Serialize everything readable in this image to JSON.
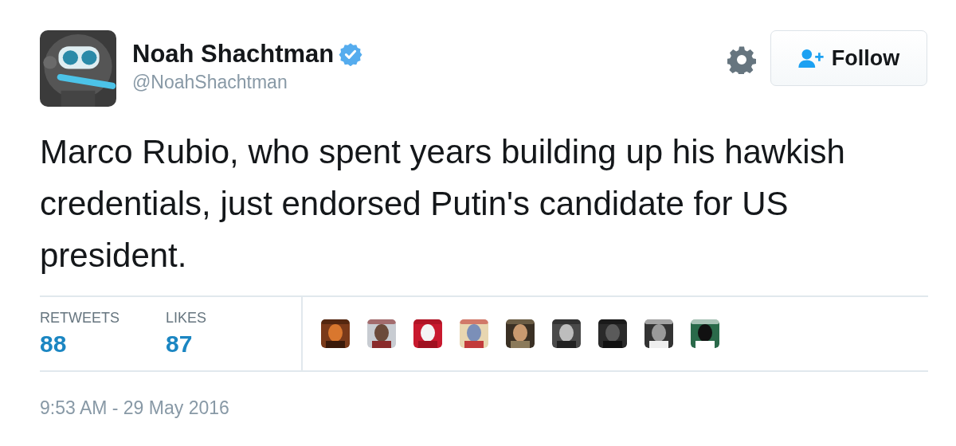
{
  "author": {
    "name": "Noah Shachtman",
    "verified": true,
    "handle": "@NoahShachtman"
  },
  "follow_button": {
    "label": "Follow"
  },
  "tweet": {
    "text": "Marco Rubio, who spent years building up his hawkish credentials, just endorsed Putin's candidate for US president."
  },
  "stats": [
    {
      "label": "RETWEETS",
      "value": "88"
    },
    {
      "label": "LIKES",
      "value": "87"
    }
  ],
  "timestamp": "9:53 AM - 29 May 2016"
}
